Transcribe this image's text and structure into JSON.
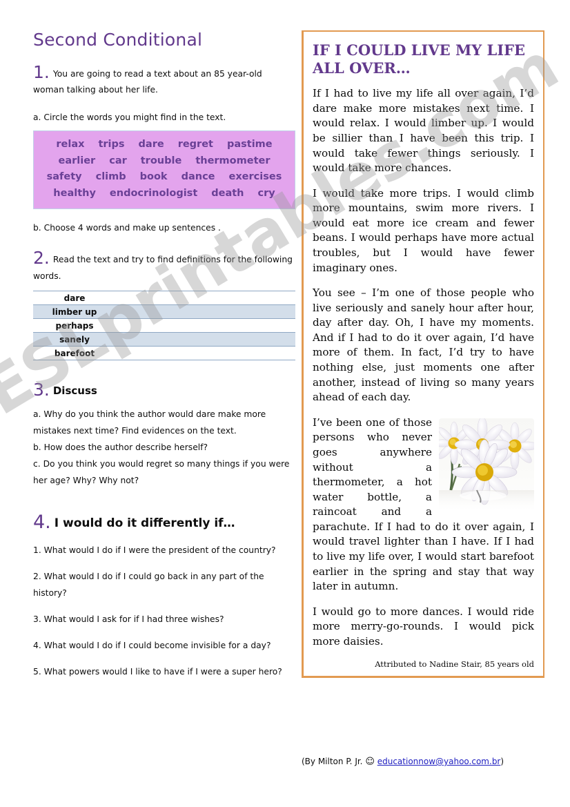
{
  "worksheet": {
    "title": "Second Conditional"
  },
  "task1": {
    "number": "1.",
    "text": "You are going to read a text about an 85 year-old woman talking about her life.",
    "sub_a": "a. Circle the words you might find in the text.",
    "sub_b": "b. Choose 4 words and make up  sentences .",
    "word_bank_rows": [
      [
        "relax",
        "trips",
        "dare",
        "regret",
        "pastime"
      ],
      [
        "earlier",
        "car",
        "trouble",
        "thermometer"
      ],
      [
        "safety",
        "climb",
        "book",
        "dance",
        "exercises"
      ],
      [
        "healthy",
        "endocrinologist",
        "death",
        "cry"
      ]
    ]
  },
  "task2": {
    "number": "2.",
    "text": "Read the text and try to find definitions for the following words.",
    "words": [
      "dare",
      "limber up",
      "perhaps",
      "sanely",
      "barefoot"
    ]
  },
  "task3": {
    "number": "3.",
    "label": "Discuss",
    "items": [
      "a. Why do you think the author would dare make more mistakes next time? Find evidences on the text.",
      "b. How does the author describe herself?",
      "c. Do you think you would regret so many things if you were her age? Why? Why not?"
    ]
  },
  "task4": {
    "number": "4.",
    "label": "I would do it differently if…",
    "questions": [
      "1. What would I do if I were the president of the country?",
      "2. What would I do if I could go back in any part of the history?",
      "3. What would I ask for if I had three wishes?",
      "4. What would I do if I could become invisible for a day?",
      "5. What powers would I like to have if I were a super hero?"
    ]
  },
  "reading": {
    "title": "IF I COULD LIVE MY LIFE ALL OVER…",
    "paragraphs": [
      "If I had to live my life all over again, I’d dare make more mistakes next time. I would relax. I would limber up. I would be sillier than I have been this trip. I would take fewer things seriously. I would take more chances.",
      "I would take more trips. I would climb more mountains, swim more rivers. I would eat more ice cream and fewer beans. I would perhaps have more actual troubles, but I would have fewer imaginary ones.",
      "You see – I’m one of those people who live seriously and sanely hour after hour, day after day. Oh, I have my moments. And if I had to do it over again, I’d have more of them. In fact, I’d try to have nothing else, just moments one after another, instead of living so many years ahead of each day.",
      "I’ve been one of those persons who never goes anywhere without a thermometer, a hot water bottle, a raincoat and a parachute. If I had to do it over again, I would travel lighter than I have. If I had to live my life over, I would start barefoot earlier in the spring and stay that way later in autumn.",
      "I would go to more dances. I would ride more merry-go-rounds. I would pick more daisies."
    ],
    "attribution": "Attributed to Nadine Stair, 85 years old",
    "image_caption": "daisies-photo"
  },
  "footer": {
    "prefix": "(By Milton P. Jr. ",
    "smiley": "☺",
    "email": "educationnow@yahoo.com.br",
    "suffix": ")"
  },
  "watermark": {
    "text": "ESLprintables.com"
  },
  "colors": {
    "accent_purple": "#62398C",
    "word_bank_bg": "#E3A4ED",
    "word_text": "#6A4096",
    "table_shade": "#D3DEEA",
    "table_rule": "#8FA8C4",
    "reading_border": "#E29A51",
    "link_blue": "#2020C0"
  }
}
